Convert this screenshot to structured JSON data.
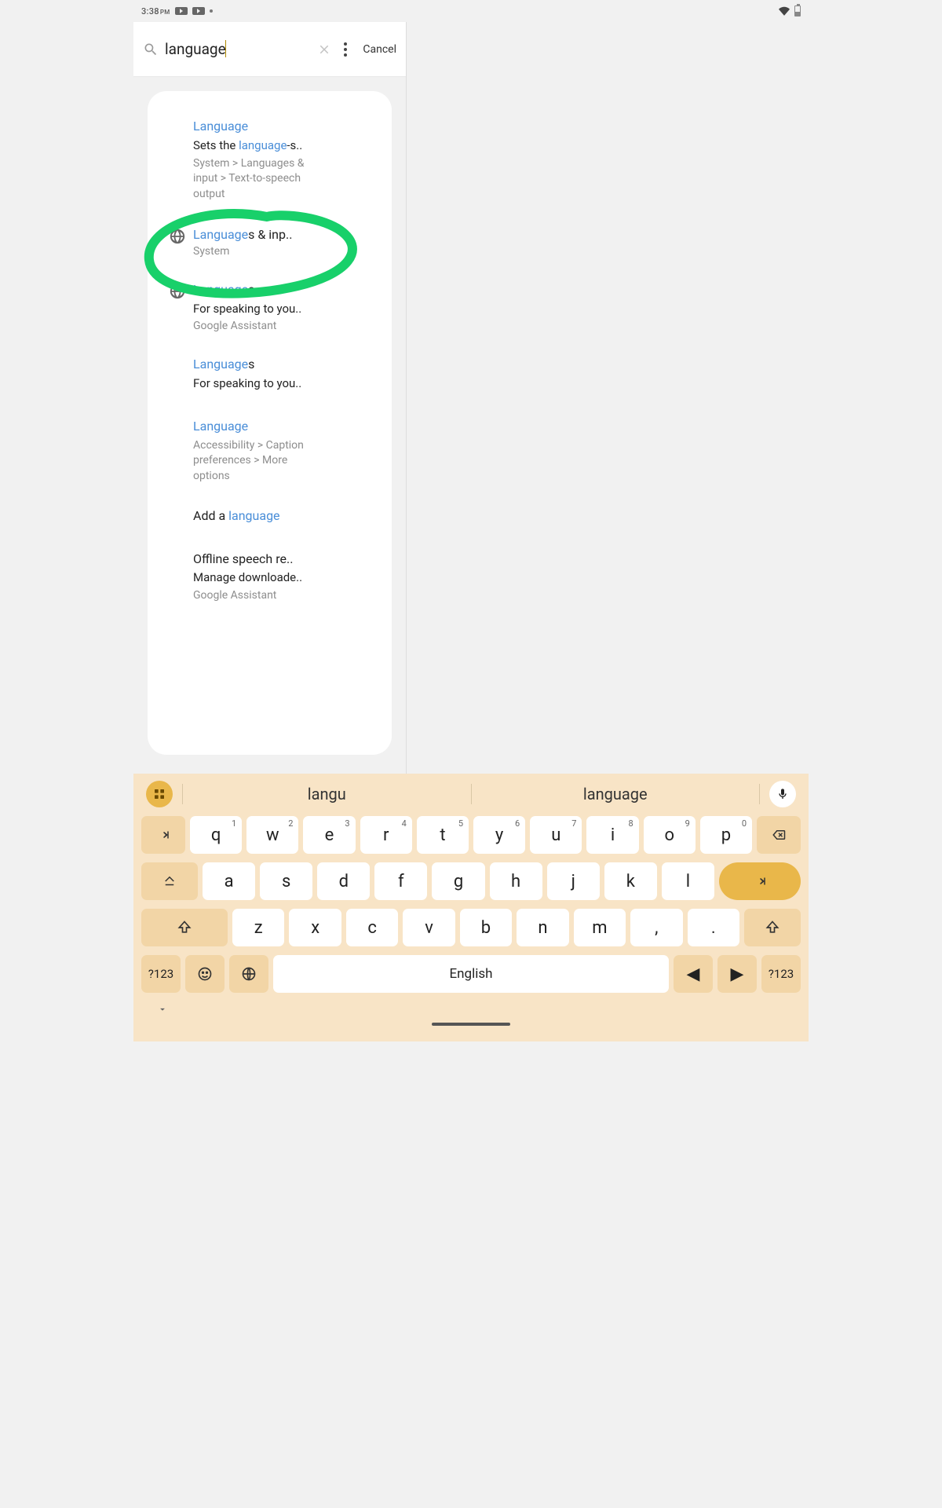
{
  "status": {
    "time": "3:38",
    "ampm": "PM"
  },
  "search": {
    "query": "language",
    "cancel": "Cancel"
  },
  "results": [
    {
      "title_hl": "Language",
      "title_rest": "",
      "sub_pre": "Sets the ",
      "sub_hl": "language",
      "sub_post": "-s..",
      "path": "System > Languages & input > Text-to-speech output",
      "icon": false
    },
    {
      "title_hl": "Language",
      "title_rest": "s & inp..",
      "single_path": "System",
      "icon": true
    },
    {
      "title_hl": "Language",
      "title_rest": "s",
      "sub": "For speaking to you..",
      "single_path": "Google Assistant",
      "icon": true
    },
    {
      "title_hl": "Language",
      "title_rest": "s",
      "sub": "For speaking to you..",
      "icon": false
    },
    {
      "title_hl": "Language",
      "title_rest": "",
      "path": "Accessibility > Caption preferences > More options",
      "icon": false
    },
    {
      "title_pre": "Add a ",
      "title_hl": "language",
      "title_rest": "",
      "icon": false
    },
    {
      "title_plain": "Offline speech re..",
      "sub": "Manage downloade..",
      "single_path": "Google Assistant",
      "icon": false
    }
  ],
  "keyboard": {
    "suggestions": [
      "langu",
      "language"
    ],
    "space_label": "English",
    "sym_label": "?123"
  }
}
